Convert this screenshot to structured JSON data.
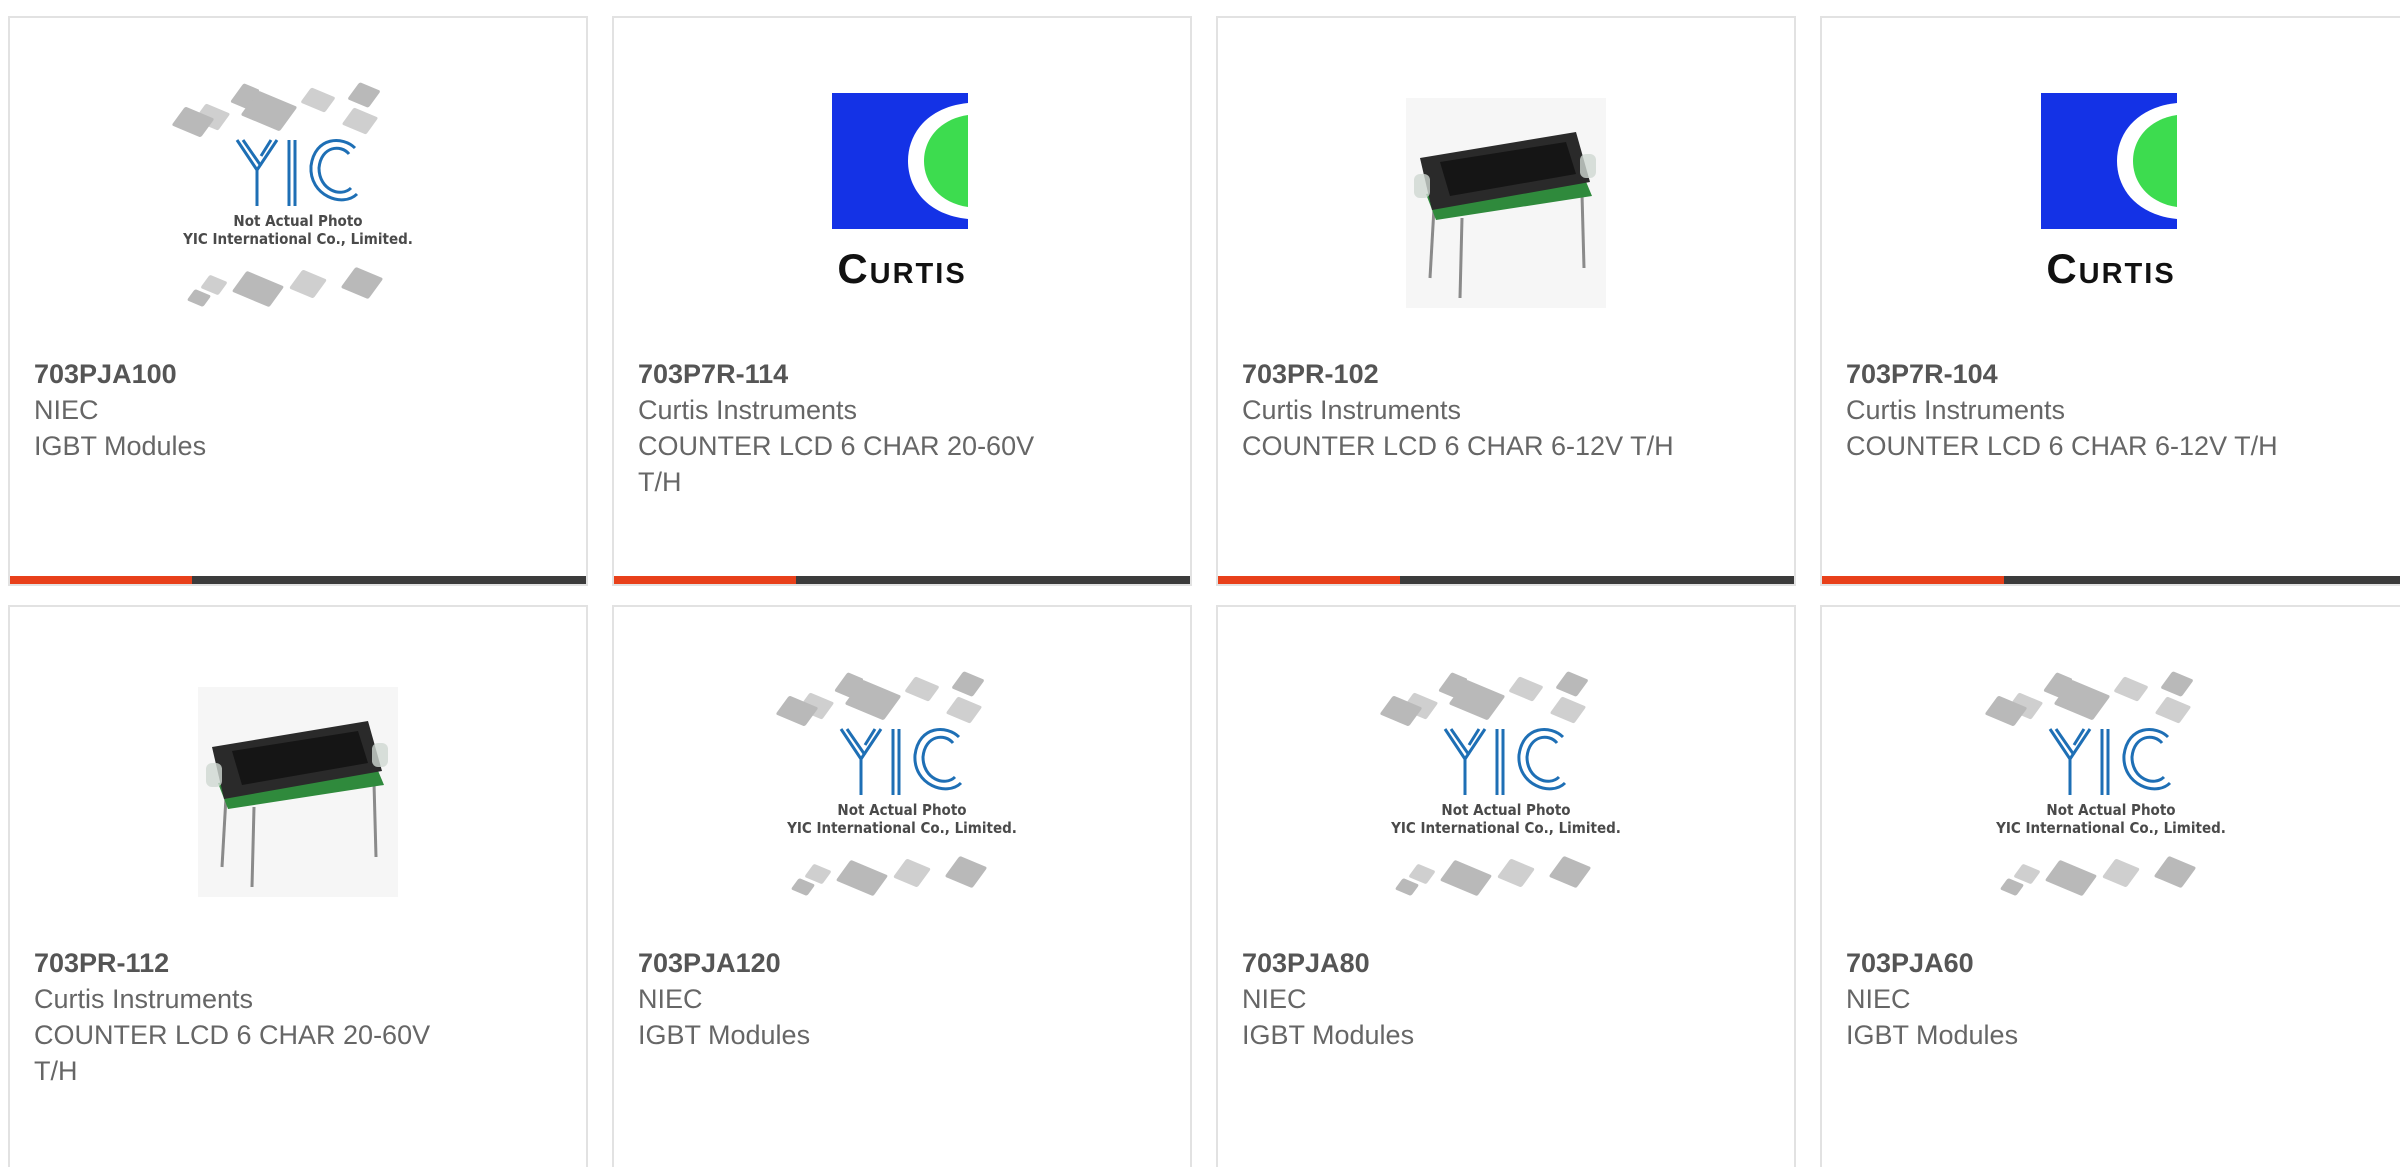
{
  "products": [
    {
      "part": "703PJA100",
      "maker": "NIEC",
      "desc": "IGBT Modules",
      "image": "placeholder",
      "note_line1": "Not Actual Photo",
      "note_line2": "YIC International Co., Limited.",
      "logo_text": "YIC"
    },
    {
      "part": "703P7R-114",
      "maker": "Curtis Instruments",
      "desc": "COUNTER LCD 6 CHAR 20-60V T/H",
      "image": "curtis-logo",
      "logo_word": "Curtis"
    },
    {
      "part": "703PR-102",
      "maker": "Curtis Instruments",
      "desc": "COUNTER LCD 6 CHAR 6-12V T/H",
      "image": "lcd-module"
    },
    {
      "part": "703P7R-104",
      "maker": "Curtis Instruments",
      "desc": "COUNTER LCD 6 CHAR 6-12V T/H",
      "image": "curtis-logo",
      "logo_word": "Curtis"
    },
    {
      "part": "703PR-112",
      "maker": "Curtis Instruments",
      "desc": "COUNTER LCD 6 CHAR 20-60V T/H",
      "image": "lcd-module"
    },
    {
      "part": "703PJA120",
      "maker": "NIEC",
      "desc": "IGBT Modules",
      "image": "placeholder",
      "note_line1": "Not Actual Photo",
      "note_line2": "YIC International Co., Limited.",
      "logo_text": "YIC"
    },
    {
      "part": "703PJA80",
      "maker": "NIEC",
      "desc": "IGBT Modules",
      "image": "placeholder",
      "note_line1": "Not Actual Photo",
      "note_line2": "YIC International Co., Limited.",
      "logo_text": "YIC"
    },
    {
      "part": "703PJA60",
      "maker": "NIEC",
      "desc": "IGBT Modules",
      "image": "placeholder",
      "note_line1": "Not Actual Photo",
      "note_line2": "YIC International Co., Limited.",
      "logo_text": "YIC"
    }
  ],
  "colors": {
    "accent": "#e8401a",
    "bar": "#3b3b3b",
    "border": "#e2e2e2",
    "curtis_blue": "#1432e6",
    "curtis_green": "#3ddc4f",
    "yic_blue": "#1e6fb5"
  }
}
